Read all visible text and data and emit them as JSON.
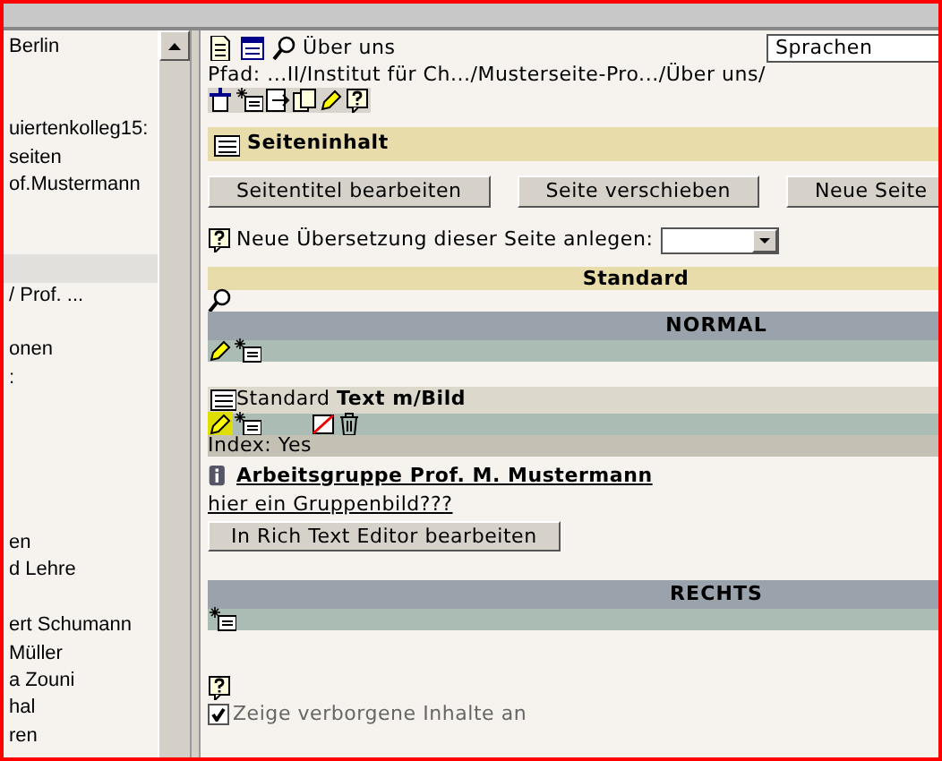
{
  "tree": {
    "items": [
      {
        "kind": "text",
        "label": "Berlin",
        "selected": false
      },
      {
        "kind": "blank"
      },
      {
        "kind": "blank"
      },
      {
        "kind": "text",
        "label": "uiertenkolleg15:",
        "selected": false
      },
      {
        "kind": "text",
        "label": "seiten",
        "selected": false
      },
      {
        "kind": "text",
        "label": "of.Mustermann",
        "selected": false
      },
      {
        "kind": "blank"
      },
      {
        "kind": "blank"
      },
      {
        "kind": "blank",
        "selected": true
      },
      {
        "kind": "text",
        "label": "/ Prof. ...",
        "selected": false
      },
      {
        "kind": "blank"
      },
      {
        "kind": "text",
        "label": "onen",
        "selected": false
      },
      {
        "kind": "text",
        "label": ":",
        "selected": false
      },
      {
        "kind": "blank"
      },
      {
        "kind": "blank"
      },
      {
        "kind": "blank"
      },
      {
        "kind": "blank"
      },
      {
        "kind": "blank"
      },
      {
        "kind": "text",
        "label": "en",
        "selected": false
      },
      {
        "kind": "text",
        "label": "d Lehre",
        "selected": false
      },
      {
        "kind": "blank"
      },
      {
        "kind": "text",
        "label": "ert Schumann",
        "selected": false
      },
      {
        "kind": "text",
        "label": "Müller",
        "selected": false
      },
      {
        "kind": "text",
        "label": "a Zouni",
        "selected": false
      },
      {
        "kind": "text",
        "label": "hal",
        "selected": false
      },
      {
        "kind": "text",
        "label": "ren",
        "selected": false
      }
    ]
  },
  "page": {
    "title": "Über uns",
    "languages": {
      "value": "Sprachen"
    },
    "path": "Pfad: ...II/Institut für Ch.../Musterseite-Pro.../Über uns/"
  },
  "content_header": "Seiteninhalt",
  "buttons": [
    "Seitentitel bearbeiten",
    "Seite verschieben",
    "Neue Seite"
  ],
  "translation": {
    "label": "Neue Übersetzung dieser Seite anlegen:"
  },
  "template_bar": "Standard",
  "sections": [
    {
      "title": "NORMAL",
      "elements": [
        {
          "type_plain": "Standard",
          "type_bold": "Text m/Bild",
          "index": "Index: Yes",
          "heading": "Arbeitsgruppe Prof. M. Mustermann",
          "body": "hier ein Gruppenbild???",
          "edit_button": "In Rich Text Editor bearbeiten"
        }
      ]
    },
    {
      "title": "RECHTS"
    }
  ],
  "show_hidden": {
    "label": "Zeige verborgene Inhalte an",
    "checked": true
  }
}
